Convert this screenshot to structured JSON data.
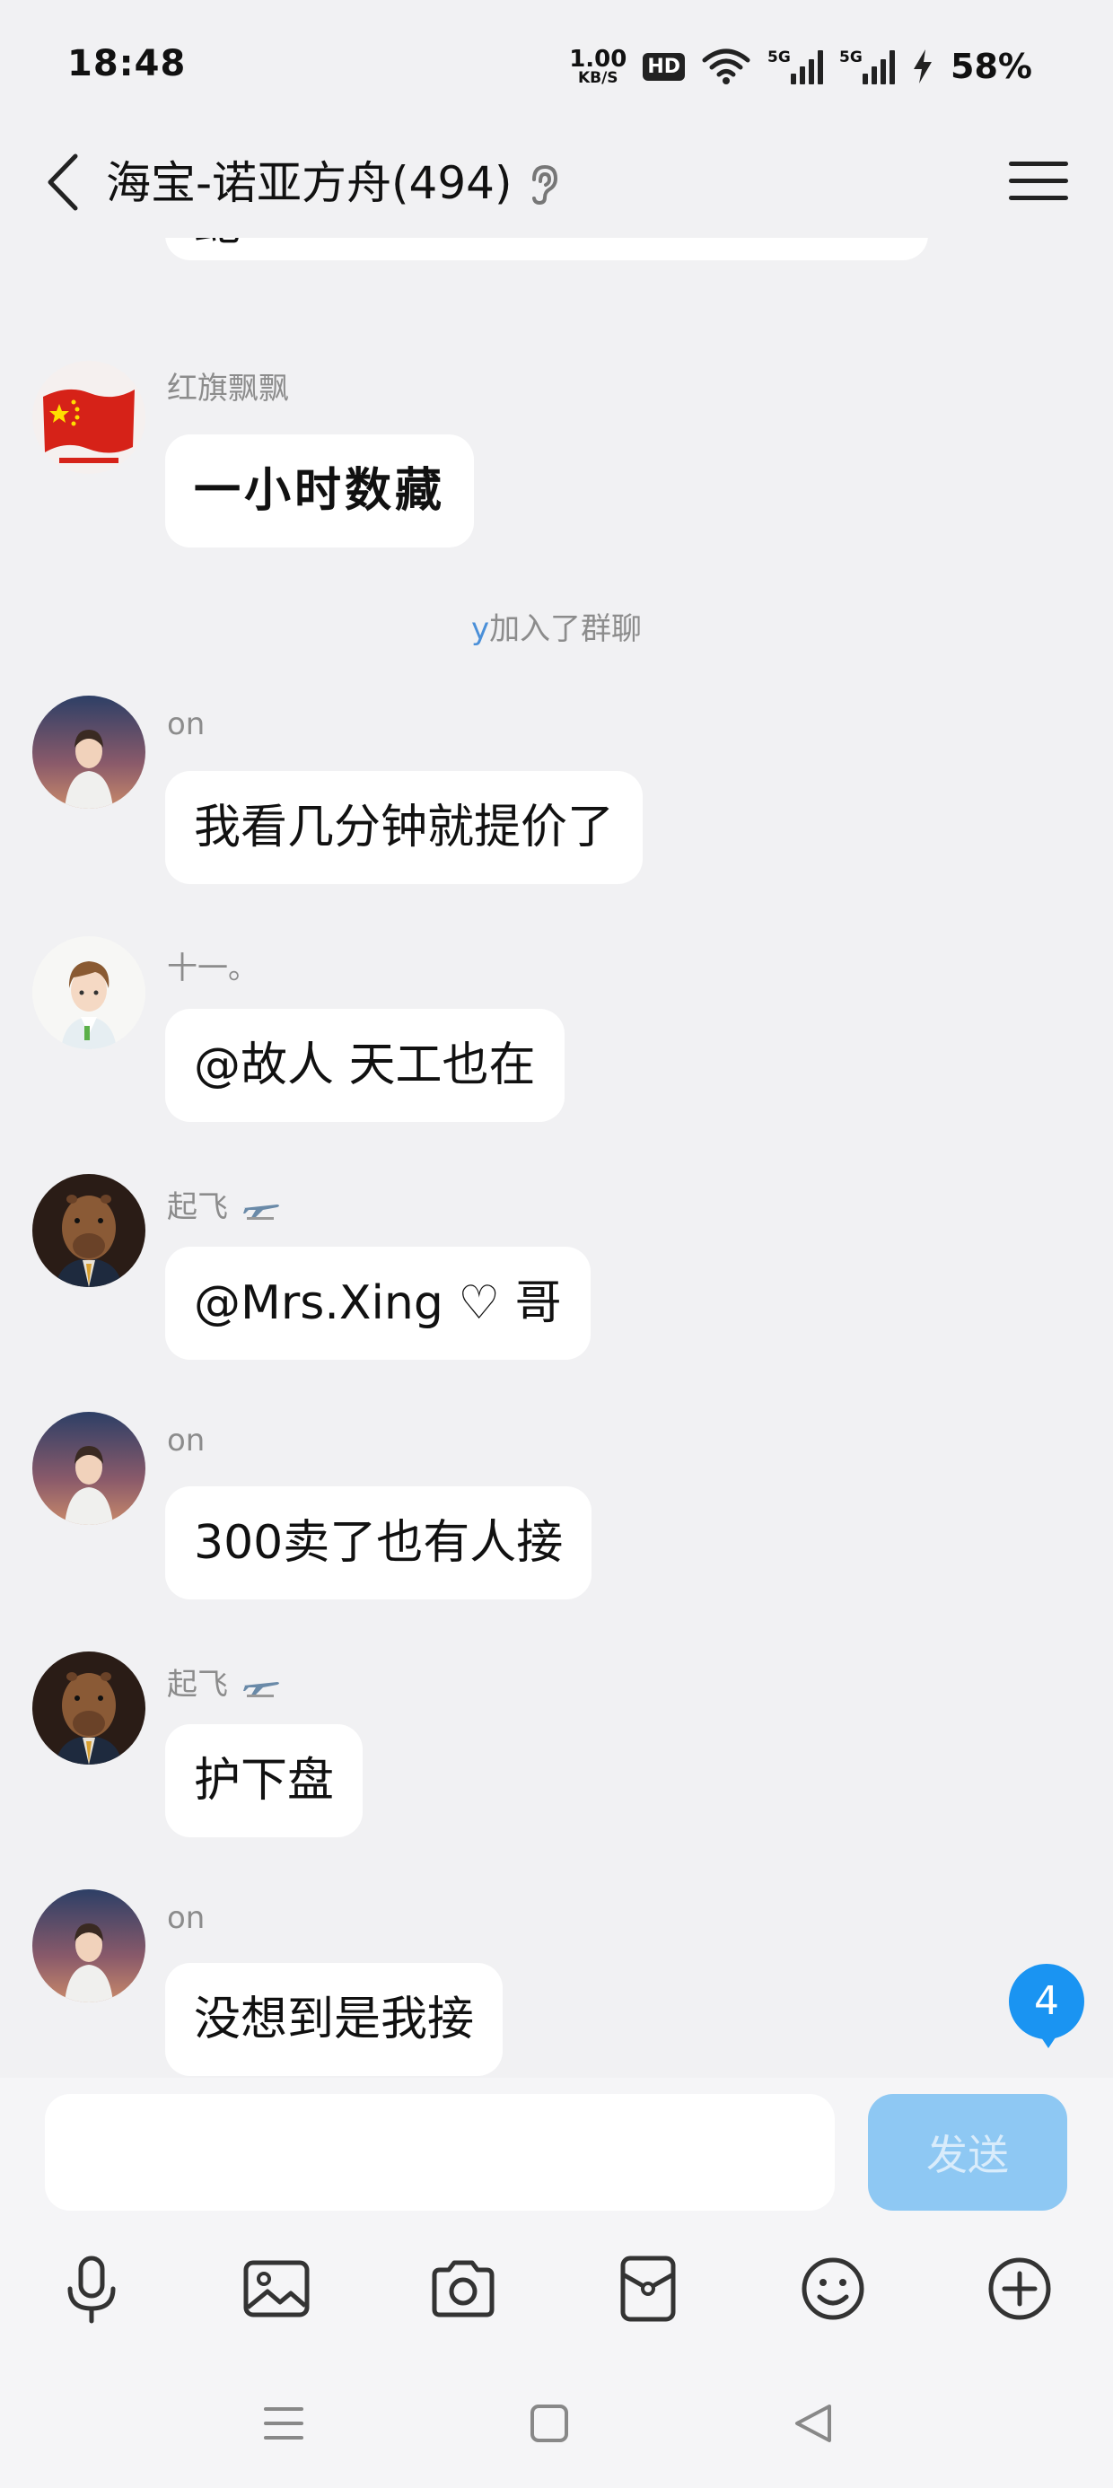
{
  "status_bar": {
    "time": "18:48",
    "net_speed_value": "1.00",
    "net_speed_unit": "KB/S",
    "hd_label": "HD",
    "signal1_label": "5G",
    "signal2_label": "5G",
    "battery": "58%"
  },
  "header": {
    "title": "海宝-诺亚方舟(494)"
  },
  "messages": [
    {
      "type": "partial",
      "text": "蛇"
    },
    {
      "sender": "红旗飘飘",
      "text": "一小时数藏",
      "avatar": "flag-avatar"
    },
    {
      "type": "system",
      "highlight": "y",
      "text": "加入了群聊"
    },
    {
      "sender": "on",
      "text": "我看几分钟就提价了",
      "avatar": "boy-avatar"
    },
    {
      "sender": "十一。",
      "text": "@故人 天工也在",
      "avatar": "cartoon-avatar"
    },
    {
      "sender": "起飞",
      "text": "@Mrs.Xing ♡ 哥",
      "avatar": "capybara-avatar"
    },
    {
      "sender": "on",
      "text": "300卖了也有人接",
      "avatar": "boy-avatar"
    },
    {
      "sender": "起飞",
      "text": "护下盘",
      "avatar": "capybara-avatar"
    },
    {
      "sender": "on",
      "text": "没想到是我接",
      "avatar": "boy-avatar"
    }
  ],
  "unread_count": "4",
  "input": {
    "placeholder": "",
    "send_label": "发送"
  },
  "toolbar": [
    "microphone-icon",
    "image-icon",
    "camera-icon",
    "red-packet-icon",
    "emoji-icon",
    "plus-icon"
  ],
  "colors": {
    "background": "#f1f1f3",
    "bubble": "#ffffff",
    "accent": "#1a94f2",
    "send_disabled": "#8ec8f3"
  }
}
